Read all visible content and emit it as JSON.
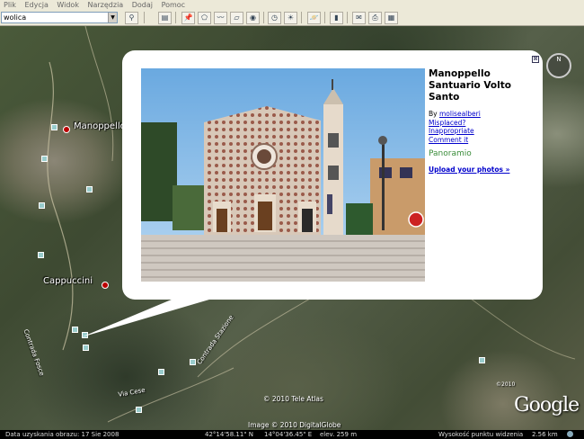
{
  "menu": [
    "Plik",
    "Edycja",
    "Widok",
    "Narzędzia",
    "Dodaj",
    "Pomoc"
  ],
  "search": {
    "value": "wolica"
  },
  "toolbar_icons": [
    "sidebar-toggle-icon",
    "placemark-icon",
    "polygon-icon",
    "path-icon",
    "image-overlay-icon",
    "record-tour-icon",
    "historical-imagery-icon",
    "sunlight-icon",
    "sky-icon",
    "ruler-icon",
    "email-icon",
    "print-icon",
    "maps-icon"
  ],
  "map": {
    "places": [
      {
        "name": "Manoppello"
      },
      {
        "name": "Cappuccini"
      }
    ],
    "roads": [
      "Contrada Fosce",
      "Contrada Stazione",
      "Via Cese"
    ],
    "copyrights": [
      "© 2010 Tele Atlas",
      "Image © 2010 DigitalGlobe",
      "©2010"
    ],
    "logo_text": "Google",
    "compass_label": "N"
  },
  "balloon": {
    "title": "Manoppello Santuario Volto Santo",
    "by_label": "By",
    "author": "molisealberi",
    "links": [
      "Misplaced?",
      "Inappropriate",
      "Comment it"
    ],
    "logo": "Panoramio",
    "upload": "Upload your photos »",
    "close_label": "⊠"
  },
  "status": {
    "date": "Data uzyskania obrazu: 17 Sie 2008",
    "lat": "42°14'58.11\" N",
    "lon": "14°04'36.45\" E",
    "elev": "elev.  259 m",
    "eye": "Wysokość punktu widzenia",
    "eye_value": "2.56 km"
  }
}
